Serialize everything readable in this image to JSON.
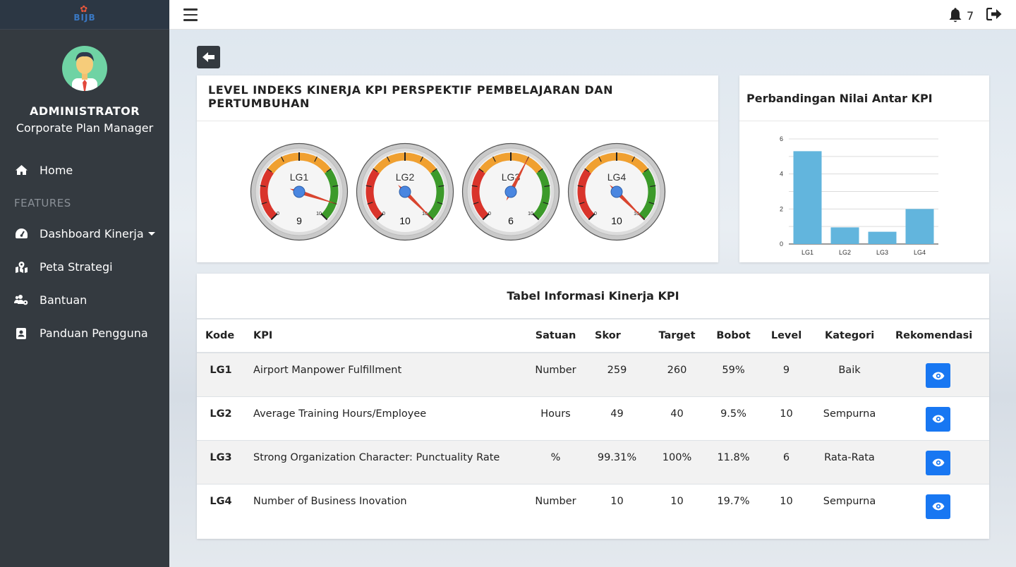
{
  "brand": {
    "logo_text": "BIJB"
  },
  "user": {
    "name": "ADMINISTRATOR",
    "role": "Corporate Plan Manager"
  },
  "sidebar": {
    "section_label": "FEATURES",
    "items": [
      {
        "label": "Home",
        "icon": "home-icon"
      },
      {
        "label": "Dashboard Kinerja",
        "icon": "tachometer-icon"
      },
      {
        "label": "Peta Strategi",
        "icon": "map-icon"
      },
      {
        "label": "Bantuan",
        "icon": "users-cog-icon"
      },
      {
        "label": "Panduan Pengguna",
        "icon": "address-card-icon"
      }
    ]
  },
  "topbar": {
    "notification_count": "7"
  },
  "gauge_panel": {
    "title": "LEVEL INDEKS KINERJA KPI PERSPEKTIF PEMBELAJARAN DAN PERTUMBUHAN",
    "scale_min": "0",
    "scale_max": "10",
    "gauges": [
      {
        "label": "LG1",
        "value": 9
      },
      {
        "label": "LG2",
        "value": 10
      },
      {
        "label": "LG3",
        "value": 6
      },
      {
        "label": "LG4",
        "value": 10
      }
    ]
  },
  "chart_data": {
    "type": "bar",
    "title": "Perbandingan Nilai Antar KPI",
    "categories": [
      "LG1",
      "LG2",
      "LG3",
      "LG4"
    ],
    "values": [
      5.3,
      0.95,
      0.7,
      2.0
    ],
    "ylim": [
      0,
      6
    ],
    "yticks": [
      0,
      2,
      4,
      6
    ],
    "grid": true,
    "color": "#62b5dd"
  },
  "table": {
    "title": "Tabel Informasi Kinerja KPI",
    "headers": [
      "Kode",
      "KPI",
      "Satuan",
      "Skor",
      "Target",
      "Bobot",
      "Level",
      "Kategori",
      "Rekomendasi"
    ],
    "rows": [
      {
        "kode": "LG1",
        "kpi": "Airport Manpower Fulfillment",
        "satuan": "Number",
        "skor": "259",
        "target": "260",
        "bobot": "59%",
        "level": "9",
        "kategori": "Baik"
      },
      {
        "kode": "LG2",
        "kpi": "Average Training Hours/Employee",
        "satuan": "Hours",
        "skor": "49",
        "target": "40",
        "bobot": "9.5%",
        "level": "10",
        "kategori": "Sempurna"
      },
      {
        "kode": "LG3",
        "kpi": "Strong Organization Character: Punctuality Rate",
        "satuan": "%",
        "skor": "99.31%",
        "target": "100%",
        "bobot": "11.8%",
        "level": "6",
        "kategori": "Rata-Rata"
      },
      {
        "kode": "LG4",
        "kpi": "Number of Business Inovation",
        "satuan": "Number",
        "skor": "10",
        "target": "10",
        "bobot": "19.7%",
        "level": "10",
        "kategori": "Sempurna"
      }
    ]
  },
  "colors": {
    "sidebar_bg": "#343a40",
    "primary": "#1877f2",
    "bar": "#62b5dd",
    "gauge_red": "#d9342b",
    "gauge_orange": "#f0a030",
    "gauge_green": "#3c9a2a"
  }
}
